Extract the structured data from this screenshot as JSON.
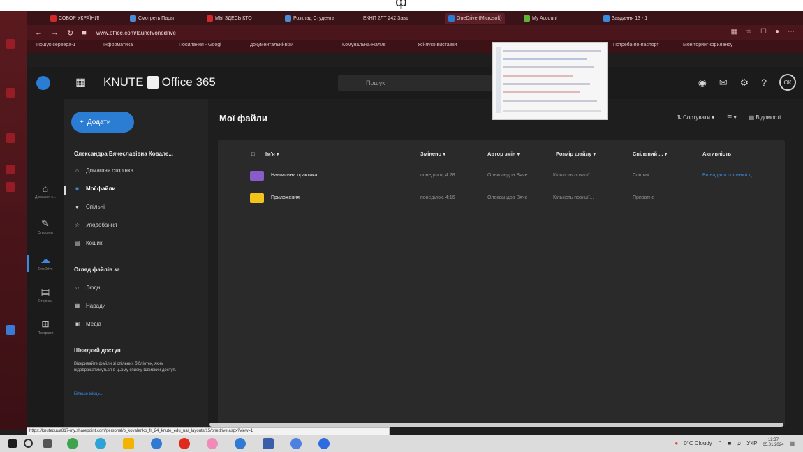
{
  "colors": {
    "accent": "#2b7cd3",
    "browser_frame": "#3a1318",
    "app_bg": "#1e1e1e",
    "nav_bg": "#242424",
    "folder_purple": "#8a5cc9",
    "folder_yellow": "#f2c318"
  },
  "browser": {
    "tabs": [
      "СОБОР УКРАЇНИ!",
      "Смотреть Пары",
      "МЫ ЗДЕСЬ КТО",
      "Розклад Студента",
      "ЕКНП 2ЛТ 242 Завд",
      "OneDrive (Microsoft)",
      "My Account",
      "Завдання 13 - 1"
    ],
    "url": "www.office.com/launch/onedrive",
    "bookmarks": [
      "Пошук-сервера-1",
      "Інформатика",
      "Посилання - Googl",
      "документальні-візи",
      "Комунальна-Налив",
      "Усі-пуск-виставки",
      "Потреба-по-паспорт",
      "Моніторинг-фрилансу"
    ]
  },
  "header": {
    "brand": "KNUTE",
    "office_label": "Office 365",
    "search_placeholder": "Пошук",
    "avatar_initials": "ОК"
  },
  "rail": {
    "items": [
      {
        "label": "Домашня с..."
      },
      {
        "label": "Створити"
      },
      {
        "label": "OneDrive"
      },
      {
        "label": "Сторінки"
      },
      {
        "label": "Програми"
      }
    ]
  },
  "nav": {
    "new_label": "Додати",
    "user_name": "Олександра Вячеславівна Ковале...",
    "items": [
      "Домашня сторінка",
      "Мої файли",
      "Спільні",
      "Уподобання",
      "Кошик"
    ],
    "browse_title": "Огляд файлів за",
    "browse_items": [
      "Люди",
      "Наради",
      "Медіа"
    ],
    "quick_title": "Швидкий доступ",
    "quick_desc": "Відкривайте файли зі спільних бібліотек, яким відображатимуться в цьому списку Швидкий доступ.",
    "quick_more": "Більше місць..."
  },
  "main": {
    "title": "Мої файли",
    "sort_label": "Сортувати",
    "details_label": "Відомості",
    "columns": [
      "Ім'я",
      "Змінено",
      "Автор змін",
      "Розмір файлу",
      "Спільний ...",
      "Активність"
    ],
    "rows": [
      {
        "name": "Навчальна практика",
        "modified": "понеділок, 4:28",
        "author": "Олександра Вяче",
        "size": "Кількість позиції...",
        "sharing": "Спільні",
        "activity": "Ви надали спільний д"
      },
      {
        "name": "Приложения",
        "modified": "понеділок, 4:16",
        "author": "Олександра Вяче",
        "size": "Кількість позиції...",
        "sharing": "Приватне",
        "activity": ""
      }
    ]
  },
  "status_url": "https://knuteduua817-my.sharepoint.com/personal/o_kovalenko_fr_24_knute_edu_ua/_layouts/15/onedrive.aspx?view=1",
  "taskbar": {
    "weather": "0°C Cloudy",
    "lang": "УКР",
    "time": "12:37",
    "date": "05.01.2024"
  }
}
